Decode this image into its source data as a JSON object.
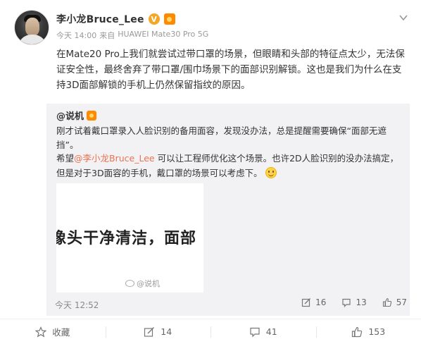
{
  "post": {
    "author_name": "李小龙Bruce_Lee",
    "verified_mark": "V",
    "time": "今天 14:00",
    "from_label": "来自",
    "device": "HUAWEI Mate30 Pro 5G",
    "text": "在Mate20 Pro上我们就尝试过带口罩的场景，但眼睛和头部的特征点太少，无法保证安全性，最终舍弃了带口罩/围巾场景下的面部识别解锁。这也是我们为什么在支持3D面部解锁的手机上仍然保留指纹的原因。"
  },
  "repost": {
    "author": "@说机",
    "text1": "刚才试着戴口罩录入人脸识别的备用面容，发现没办法，总是提醒需要确保“面部无遮挡”。",
    "text2_before": "希望",
    "text2_mention": "@李小龙Bruce_Lee",
    "text2_after": " 可以让工程师优化这个场景。也许2D人脸识别的没办法搞定，但是对于3D面容的手机，戴口罩的场景可以考虑下。",
    "image_caption": "像头干净清洁，面部",
    "image_watermark": "@说机",
    "time": "今天 12:52",
    "share_count": "16",
    "comment_count": "13",
    "like_count": "57"
  },
  "actions": {
    "favorite_label": "收藏",
    "repost_count": "14",
    "comment_count": "41",
    "like_count": "153"
  },
  "colors": {
    "accent": "#eb7350",
    "verified": "#f5a623",
    "repost_bg": "#f2f2f5"
  }
}
